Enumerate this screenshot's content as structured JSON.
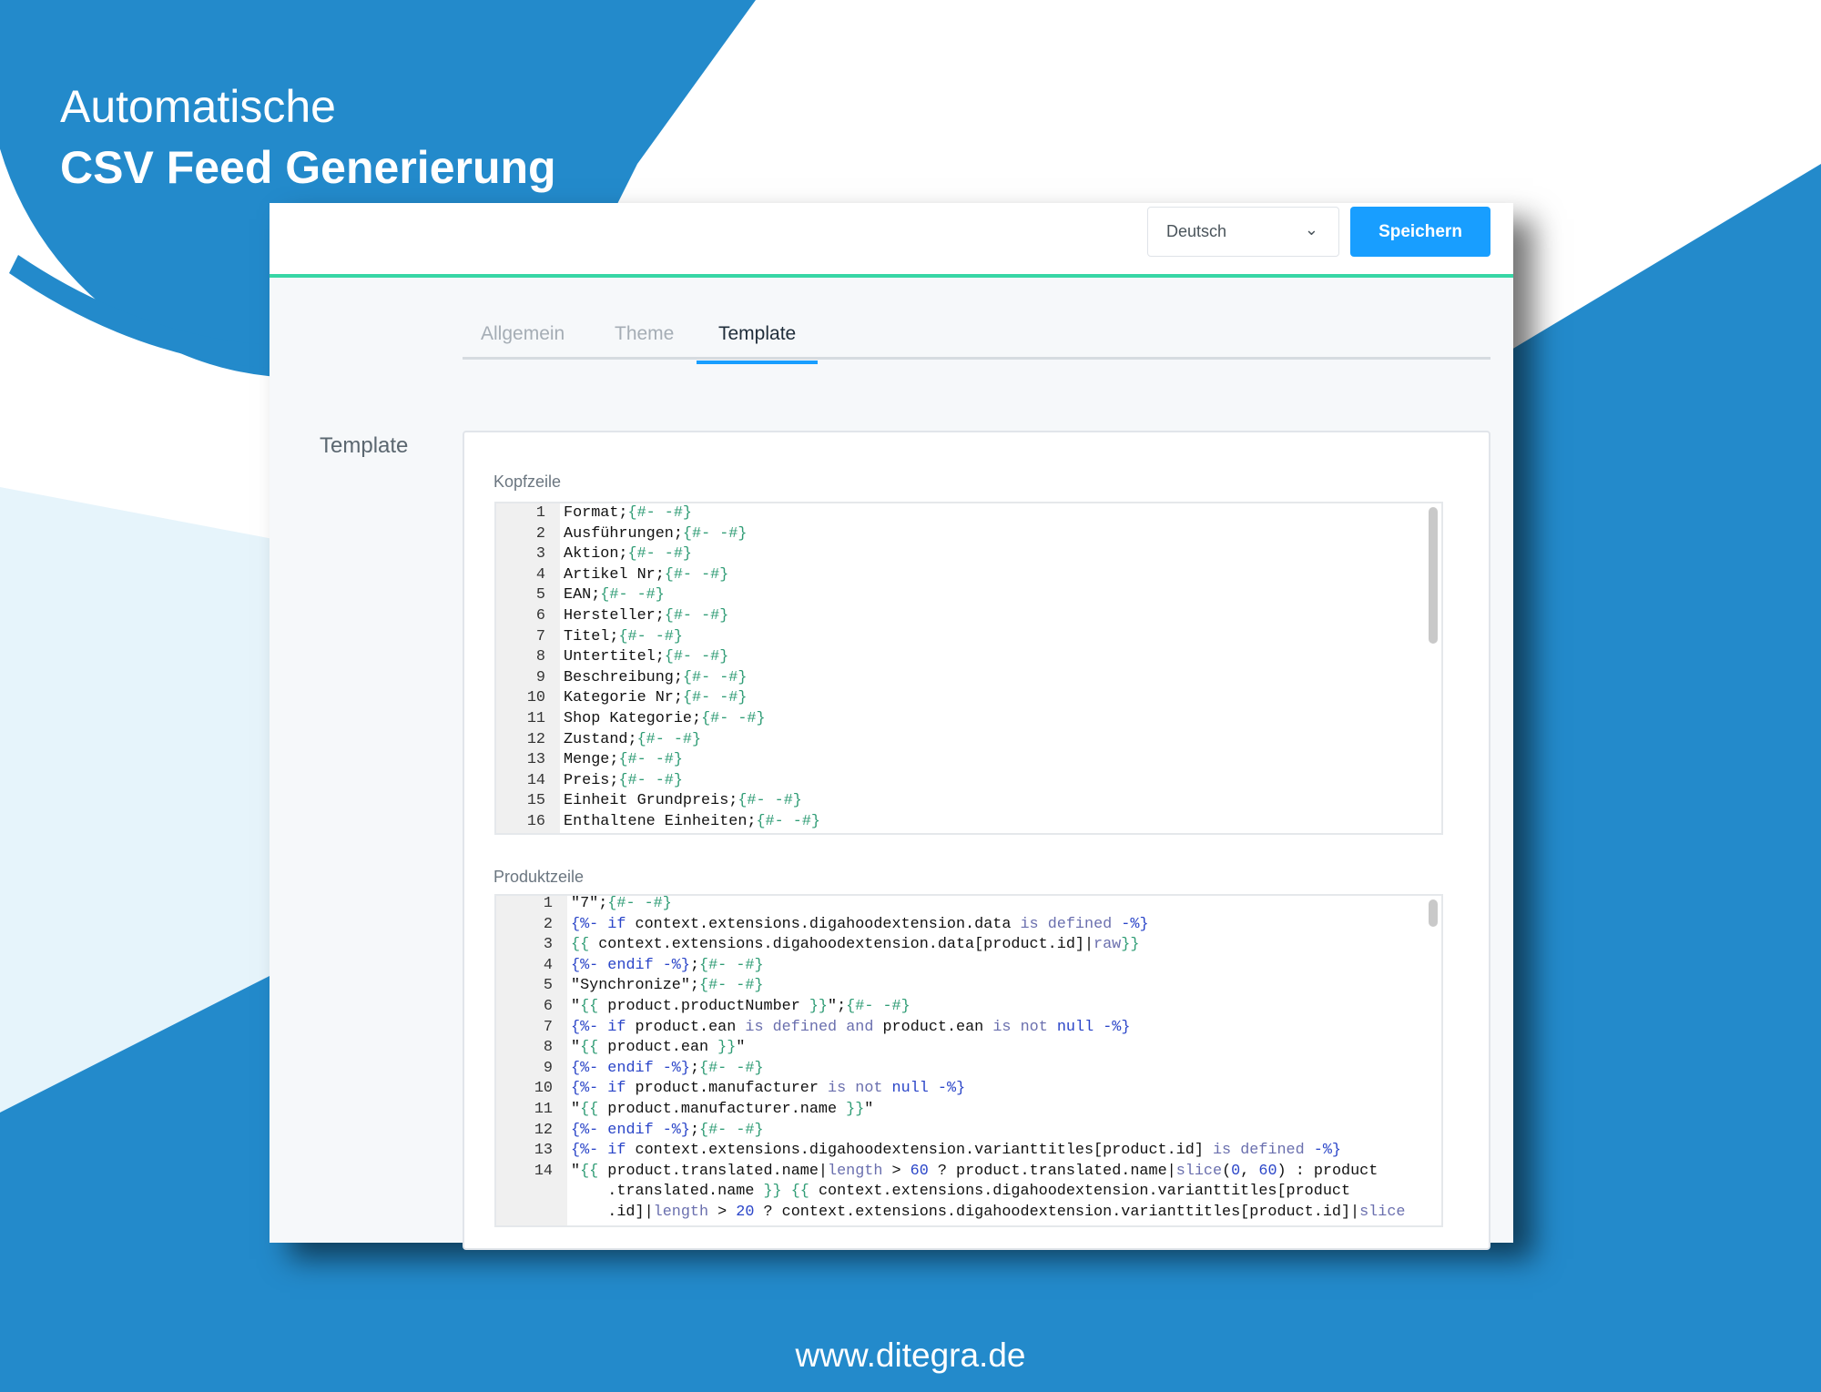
{
  "colors": {
    "brand_blue": "#238acb",
    "light_blue": "#e6f4fb",
    "accent_green": "#37d6a5",
    "primary_button": "#189eff"
  },
  "hero": {
    "line1": "Automatische",
    "line2": "CSV Feed Generierung"
  },
  "header": {
    "language_select": "Deutsch",
    "save_label": "Speichern",
    "chevron_icon": "chevron-down-icon"
  },
  "tabs": [
    {
      "label": "Allgemein",
      "active": false
    },
    {
      "label": "Theme",
      "active": false
    },
    {
      "label": "Template",
      "active": true
    }
  ],
  "section_label": "Template",
  "kopfzeile": {
    "label": "Kopfzeile",
    "lines": [
      "Format;{#- -#}",
      "Ausführungen;{#- -#}",
      "Aktion;{#- -#}",
      "Artikel Nr;{#- -#}",
      "EAN;{#- -#}",
      "Hersteller;{#- -#}",
      "Titel;{#- -#}",
      "Untertitel;{#- -#}",
      "Beschreibung;{#- -#}",
      "Kategorie Nr;{#- -#}",
      "Shop Kategorie;{#- -#}",
      "Zustand;{#- -#}",
      "Menge;{#- -#}",
      "Preis;{#- -#}",
      "Einheit Grundpreis;{#- -#}",
      "Enthaltene Einheiten;{#- -#}"
    ]
  },
  "produktzeile": {
    "label": "Produktzeile",
    "lines": [
      "\"7\";{#- -#}",
      "{%- if context.extensions.digahoodextension.data is defined -%}",
      "{{ context.extensions.digahoodextension.data[product.id]|raw}}",
      "{%- endif -%};{#- -#}",
      "\"Synchronize\";{#- -#}",
      "\"{{ product.productNumber }}\";{#- -#}",
      "{%- if product.ean is defined and product.ean is not null -%}",
      "\"{{ product.ean }}\"",
      "{%- endif -%};{#- -#}",
      "{%- if product.manufacturer is not null -%}",
      "\"{{ product.manufacturer.name }}\"",
      "{%- endif -%};{#- -#}",
      "{%- if context.extensions.digahoodextension.varianttitles[product.id] is defined -%}",
      "\"{{ product.translated.name|length > 60 ? product.translated.name|slice(0, 60) : product\n    .translated.name }} {{ context.extensions.digahoodextension.varianttitles[product\n    .id]|length > 20 ? context.extensions.digahoodextension.varianttitles[product.id]|slice"
    ]
  },
  "footer": "www.ditegra.de"
}
